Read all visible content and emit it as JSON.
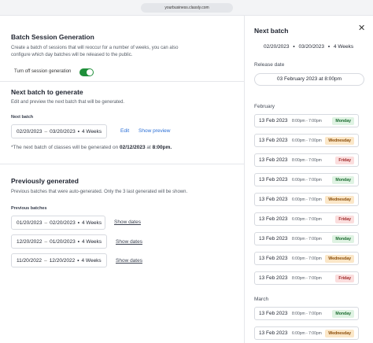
{
  "browser": {
    "url": "yourbusiness.classly.com"
  },
  "main": {
    "title": "Batch Session Generation",
    "description_line1": "Create a batch of sessions that will reoccur for a number of weeks, you can also",
    "description_line2": "configure which day batches will be released to the public.",
    "toggle_label": "Turn off session generation",
    "toggle_on": true,
    "next_batch": {
      "heading": "Next batch to generate",
      "description": "Edit and preview the next batch that will be generated.",
      "field_label": "Next batch",
      "start": "02/20/2023",
      "sep": "–",
      "end": "03/20/2023",
      "dot": "•",
      "weeks": "4 Weeks",
      "edit_label": "Edit",
      "preview_label": "Show preview",
      "note_prefix": "*The next batch of classes will be generated on",
      "note_date": "02/12/2023",
      "note_at": "at",
      "note_time": "8:00pm."
    },
    "previous": {
      "heading": "Previously generated",
      "description": "Previous batches that were auto-generated. Only the 3 last generated will be shown.",
      "field_label": "Previous batches",
      "show_dates_label": "Show dates",
      "batches": [
        {
          "start": "01/20/2023",
          "end": "02/20/2023",
          "weeks": "4 Weeks"
        },
        {
          "start": "12/20/2022",
          "end": "01/20/2023",
          "weeks": "4 Weeks"
        },
        {
          "start": "11/20/2022",
          "end": "12/20/2022",
          "weeks": "4 Weeks"
        }
      ]
    }
  },
  "panel": {
    "title": "Next batch",
    "range_start": "02/20/2023",
    "range_end": "03/20/2023",
    "range_weeks": "4 Weeks",
    "release_label": "Release date",
    "release_value": "03 February 2023 at 8:00pm",
    "months": [
      {
        "name": "February",
        "sessions": [
          {
            "date": "13 Feb 2023",
            "time": "8:00pm - 7:00pm",
            "day": "Monday"
          },
          {
            "date": "13 Feb 2023",
            "time": "6:00pm - 7:00pm",
            "day": "Wednesday"
          },
          {
            "date": "13 Feb 2023",
            "time": "8:00pm - 7:00pm",
            "day": "Friday"
          },
          {
            "date": "13 Feb 2023",
            "time": "6:00pm - 7:00pm",
            "day": "Monday"
          },
          {
            "date": "13 Feb 2023",
            "time": "6:00pm - 7:00pm",
            "day": "Wednesday"
          },
          {
            "date": "13 Feb 2023",
            "time": "6:00pm - 7:00pm",
            "day": "Friday"
          },
          {
            "date": "13 Feb 2023",
            "time": "8:00pm - 7:00pm",
            "day": "Monday"
          },
          {
            "date": "13 Feb 2023",
            "time": "6:00pm - 7:00pm",
            "day": "Wednesday"
          },
          {
            "date": "13 Feb 2023",
            "time": "8:00pm - 7:00pm",
            "day": "Friday"
          }
        ]
      },
      {
        "name": "March",
        "sessions": [
          {
            "date": "13 Feb 2023",
            "time": "8:00pm - 7:00pm",
            "day": "Monday"
          },
          {
            "date": "13 Feb 2023",
            "time": "6:00pm - 7:00pm",
            "day": "Wednesday"
          }
        ]
      }
    ]
  },
  "colors": {
    "accent": "#1f8f3a",
    "link": "#2b6fd6"
  }
}
